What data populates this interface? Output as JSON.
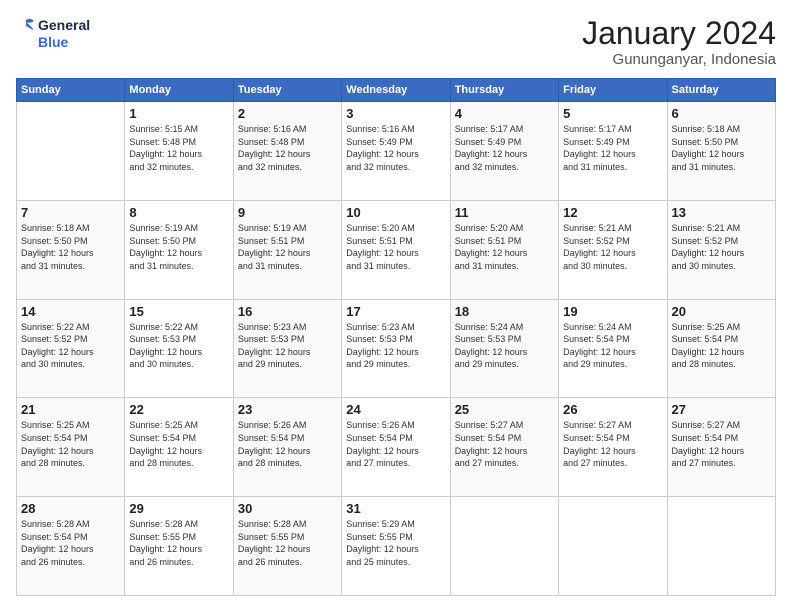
{
  "logo": {
    "line1": "General",
    "line2": "Blue"
  },
  "title": "January 2024",
  "location": "Gununganyar, Indonesia",
  "days_header": [
    "Sunday",
    "Monday",
    "Tuesday",
    "Wednesday",
    "Thursday",
    "Friday",
    "Saturday"
  ],
  "weeks": [
    [
      {
        "num": "",
        "info": ""
      },
      {
        "num": "1",
        "info": "Sunrise: 5:15 AM\nSunset: 5:48 PM\nDaylight: 12 hours\nand 32 minutes."
      },
      {
        "num": "2",
        "info": "Sunrise: 5:16 AM\nSunset: 5:48 PM\nDaylight: 12 hours\nand 32 minutes."
      },
      {
        "num": "3",
        "info": "Sunrise: 5:16 AM\nSunset: 5:49 PM\nDaylight: 12 hours\nand 32 minutes."
      },
      {
        "num": "4",
        "info": "Sunrise: 5:17 AM\nSunset: 5:49 PM\nDaylight: 12 hours\nand 32 minutes."
      },
      {
        "num": "5",
        "info": "Sunrise: 5:17 AM\nSunset: 5:49 PM\nDaylight: 12 hours\nand 31 minutes."
      },
      {
        "num": "6",
        "info": "Sunrise: 5:18 AM\nSunset: 5:50 PM\nDaylight: 12 hours\nand 31 minutes."
      }
    ],
    [
      {
        "num": "7",
        "info": "Sunrise: 5:18 AM\nSunset: 5:50 PM\nDaylight: 12 hours\nand 31 minutes."
      },
      {
        "num": "8",
        "info": "Sunrise: 5:19 AM\nSunset: 5:50 PM\nDaylight: 12 hours\nand 31 minutes."
      },
      {
        "num": "9",
        "info": "Sunrise: 5:19 AM\nSunset: 5:51 PM\nDaylight: 12 hours\nand 31 minutes."
      },
      {
        "num": "10",
        "info": "Sunrise: 5:20 AM\nSunset: 5:51 PM\nDaylight: 12 hours\nand 31 minutes."
      },
      {
        "num": "11",
        "info": "Sunrise: 5:20 AM\nSunset: 5:51 PM\nDaylight: 12 hours\nand 31 minutes."
      },
      {
        "num": "12",
        "info": "Sunrise: 5:21 AM\nSunset: 5:52 PM\nDaylight: 12 hours\nand 30 minutes."
      },
      {
        "num": "13",
        "info": "Sunrise: 5:21 AM\nSunset: 5:52 PM\nDaylight: 12 hours\nand 30 minutes."
      }
    ],
    [
      {
        "num": "14",
        "info": "Sunrise: 5:22 AM\nSunset: 5:52 PM\nDaylight: 12 hours\nand 30 minutes."
      },
      {
        "num": "15",
        "info": "Sunrise: 5:22 AM\nSunset: 5:53 PM\nDaylight: 12 hours\nand 30 minutes."
      },
      {
        "num": "16",
        "info": "Sunrise: 5:23 AM\nSunset: 5:53 PM\nDaylight: 12 hours\nand 29 minutes."
      },
      {
        "num": "17",
        "info": "Sunrise: 5:23 AM\nSunset: 5:53 PM\nDaylight: 12 hours\nand 29 minutes."
      },
      {
        "num": "18",
        "info": "Sunrise: 5:24 AM\nSunset: 5:53 PM\nDaylight: 12 hours\nand 29 minutes."
      },
      {
        "num": "19",
        "info": "Sunrise: 5:24 AM\nSunset: 5:54 PM\nDaylight: 12 hours\nand 29 minutes."
      },
      {
        "num": "20",
        "info": "Sunrise: 5:25 AM\nSunset: 5:54 PM\nDaylight: 12 hours\nand 28 minutes."
      }
    ],
    [
      {
        "num": "21",
        "info": "Sunrise: 5:25 AM\nSunset: 5:54 PM\nDaylight: 12 hours\nand 28 minutes."
      },
      {
        "num": "22",
        "info": "Sunrise: 5:25 AM\nSunset: 5:54 PM\nDaylight: 12 hours\nand 28 minutes."
      },
      {
        "num": "23",
        "info": "Sunrise: 5:26 AM\nSunset: 5:54 PM\nDaylight: 12 hours\nand 28 minutes."
      },
      {
        "num": "24",
        "info": "Sunrise: 5:26 AM\nSunset: 5:54 PM\nDaylight: 12 hours\nand 27 minutes."
      },
      {
        "num": "25",
        "info": "Sunrise: 5:27 AM\nSunset: 5:54 PM\nDaylight: 12 hours\nand 27 minutes."
      },
      {
        "num": "26",
        "info": "Sunrise: 5:27 AM\nSunset: 5:54 PM\nDaylight: 12 hours\nand 27 minutes."
      },
      {
        "num": "27",
        "info": "Sunrise: 5:27 AM\nSunset: 5:54 PM\nDaylight: 12 hours\nand 27 minutes."
      }
    ],
    [
      {
        "num": "28",
        "info": "Sunrise: 5:28 AM\nSunset: 5:54 PM\nDaylight: 12 hours\nand 26 minutes."
      },
      {
        "num": "29",
        "info": "Sunrise: 5:28 AM\nSunset: 5:55 PM\nDaylight: 12 hours\nand 26 minutes."
      },
      {
        "num": "30",
        "info": "Sunrise: 5:28 AM\nSunset: 5:55 PM\nDaylight: 12 hours\nand 26 minutes."
      },
      {
        "num": "31",
        "info": "Sunrise: 5:29 AM\nSunset: 5:55 PM\nDaylight: 12 hours\nand 25 minutes."
      },
      {
        "num": "",
        "info": ""
      },
      {
        "num": "",
        "info": ""
      },
      {
        "num": "",
        "info": ""
      }
    ]
  ]
}
